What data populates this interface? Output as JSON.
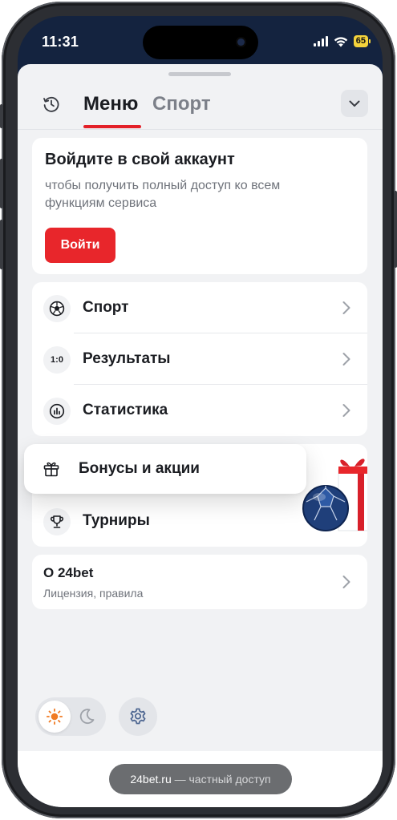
{
  "status_bar": {
    "time": "11:31",
    "battery": "65"
  },
  "header": {
    "tabs": [
      {
        "label": "Меню",
        "active": true
      },
      {
        "label": "Спорт",
        "active": false
      }
    ]
  },
  "login_card": {
    "title": "Войдите в свой аккаунт",
    "subtitle": "чтобы получить полный доступ ко всем функциям сервиса",
    "button_label": "Войти"
  },
  "nav_items": [
    {
      "label": "Спорт",
      "icon": "soccer-ball-icon"
    },
    {
      "label": "Результаты",
      "icon": "score-icon",
      "icon_text": "1:0"
    },
    {
      "label": "Статистика",
      "icon": "statistics-icon"
    }
  ],
  "promo": {
    "bonuses_label": "Бонусы и акции",
    "tournaments_label": "Турниры"
  },
  "about": {
    "title": "О 24bet",
    "subtitle": "Лицензия, правила"
  },
  "toast": {
    "domain": "24bet.ru",
    "suffix": "— частный доступ"
  },
  "colors": {
    "accent": "#e8262b",
    "status_bar_bg": "#14233f",
    "sheet_bg": "#f1f2f4"
  }
}
